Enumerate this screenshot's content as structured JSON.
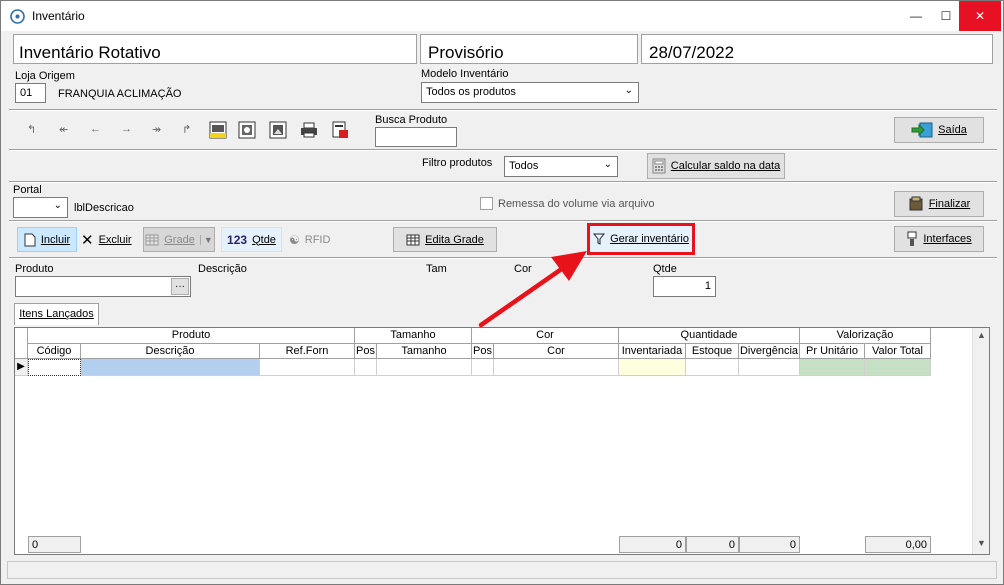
{
  "window": {
    "title": "Inventário",
    "minimize": "—",
    "maximize": "☐",
    "close": "✕"
  },
  "header": {
    "title": "Inventário Rotativo",
    "status": "Provisório",
    "date": "28/07/2022",
    "loja_label": "Loja Origem",
    "loja_code": "01",
    "loja_name": "FRANQUIA ACLIMAÇÃO",
    "modelo_label": "Modelo Inventário",
    "modelo_value": "Todos os produtos"
  },
  "toolbar": {
    "busca_label": "Busca Produto",
    "busca_value": "",
    "saida_label": "Saída",
    "filtro_label": "Filtro produtos",
    "filtro_value": "Todos",
    "calcular_label": "Calcular saldo na data"
  },
  "portal": {
    "label": "Portal",
    "value": "",
    "descricao": "lblDescricao",
    "remessa_label": "Remessa do volume via arquivo",
    "finalizar_label": "Finalizar"
  },
  "actions": {
    "incluir": "Incluir",
    "excluir": "Excluir",
    "grade": "Grade",
    "qtde_prefix": "123",
    "qtde": "Qtde",
    "rfid": "RFID",
    "edita_grade": "Edita Grade",
    "gerar": "Gerar inventário",
    "interfaces": "Interfaces"
  },
  "entry": {
    "produto_label": "Produto",
    "descricao_label": "Descrição",
    "tam_label": "Tam",
    "cor_label": "Cor",
    "qtde_label": "Qtde",
    "qtde_value": "1",
    "lookup": "···"
  },
  "tab": {
    "label": "Itens Lançados"
  },
  "grid": {
    "groups": [
      "Produto",
      "Tamanho",
      "Cor",
      "Quantidade",
      "Valorização"
    ],
    "columns": [
      "Código",
      "Descrição",
      "Ref.Forn",
      "Pos",
      "Tamanho",
      "Pos",
      "Cor",
      "Inventariada",
      "Estoque",
      "Divergência",
      "Pr Unitário",
      "Valor Total"
    ],
    "footer": {
      "count": "0",
      "inventariada": "0",
      "estoque": "0",
      "divergencia": "0",
      "valor_total": "0,00"
    }
  },
  "colors": {
    "highlight": "#e8121a",
    "arrow": "#e8121a",
    "selected_cell": "#b3cfef",
    "inventariada_cell": "#ffffe0",
    "valor_cell": "#c6e0c6"
  }
}
